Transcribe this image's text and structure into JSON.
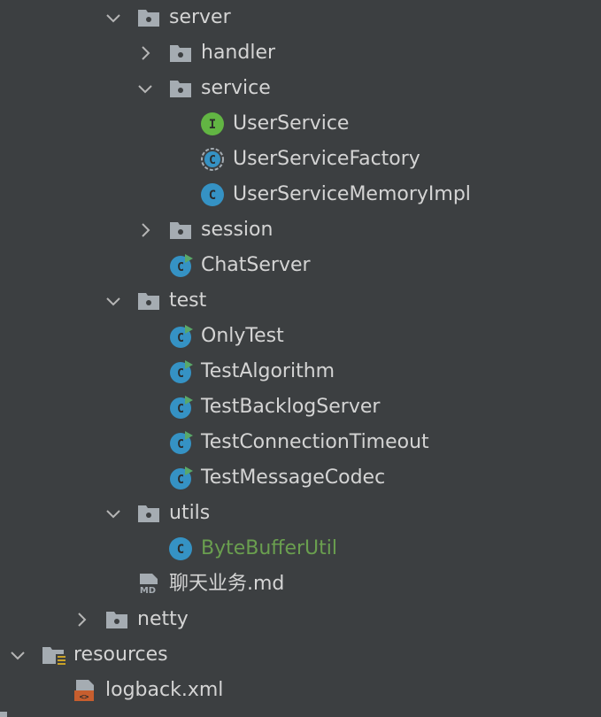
{
  "tree": {
    "items": [
      {
        "label": "server",
        "kind": "folder",
        "expanded": true
      },
      {
        "label": "handler",
        "kind": "folder",
        "expanded": false
      },
      {
        "label": "service",
        "kind": "folder",
        "expanded": true
      },
      {
        "label": "UserService",
        "kind": "interface"
      },
      {
        "label": "UserServiceFactory",
        "kind": "abstract-class"
      },
      {
        "label": "UserServiceMemoryImpl",
        "kind": "class"
      },
      {
        "label": "session",
        "kind": "folder",
        "expanded": false
      },
      {
        "label": "ChatServer",
        "kind": "runnable-class"
      },
      {
        "label": "test",
        "kind": "folder",
        "expanded": true
      },
      {
        "label": "OnlyTest",
        "kind": "runnable-class"
      },
      {
        "label": "TestAlgorithm",
        "kind": "runnable-class"
      },
      {
        "label": "TestBacklogServer",
        "kind": "runnable-class"
      },
      {
        "label": "TestConnectionTimeout",
        "kind": "runnable-class"
      },
      {
        "label": "TestMessageCodec",
        "kind": "runnable-class"
      },
      {
        "label": "utils",
        "kind": "folder",
        "expanded": true
      },
      {
        "label": "ByteBufferUtil",
        "kind": "class",
        "color": "#6a9f4f"
      },
      {
        "label": "聊天业务.md",
        "kind": "markdown-file",
        "icon_text": "MD"
      },
      {
        "label": "netty",
        "kind": "folder",
        "expanded": false
      },
      {
        "label": "resources",
        "kind": "resources-folder",
        "expanded": true
      },
      {
        "label": "logback.xml",
        "kind": "xml-file",
        "icon_text": "<>"
      }
    ]
  },
  "colors": {
    "background": "#3c3f41",
    "text": "#d4d4d4",
    "folder": "#a5acb2",
    "class_icon": "#3592c4",
    "interface_icon": "#62b543",
    "run_badge": "#59a869",
    "xml_icon": "#c75e2e",
    "modified_text": "#6a9f4f"
  }
}
